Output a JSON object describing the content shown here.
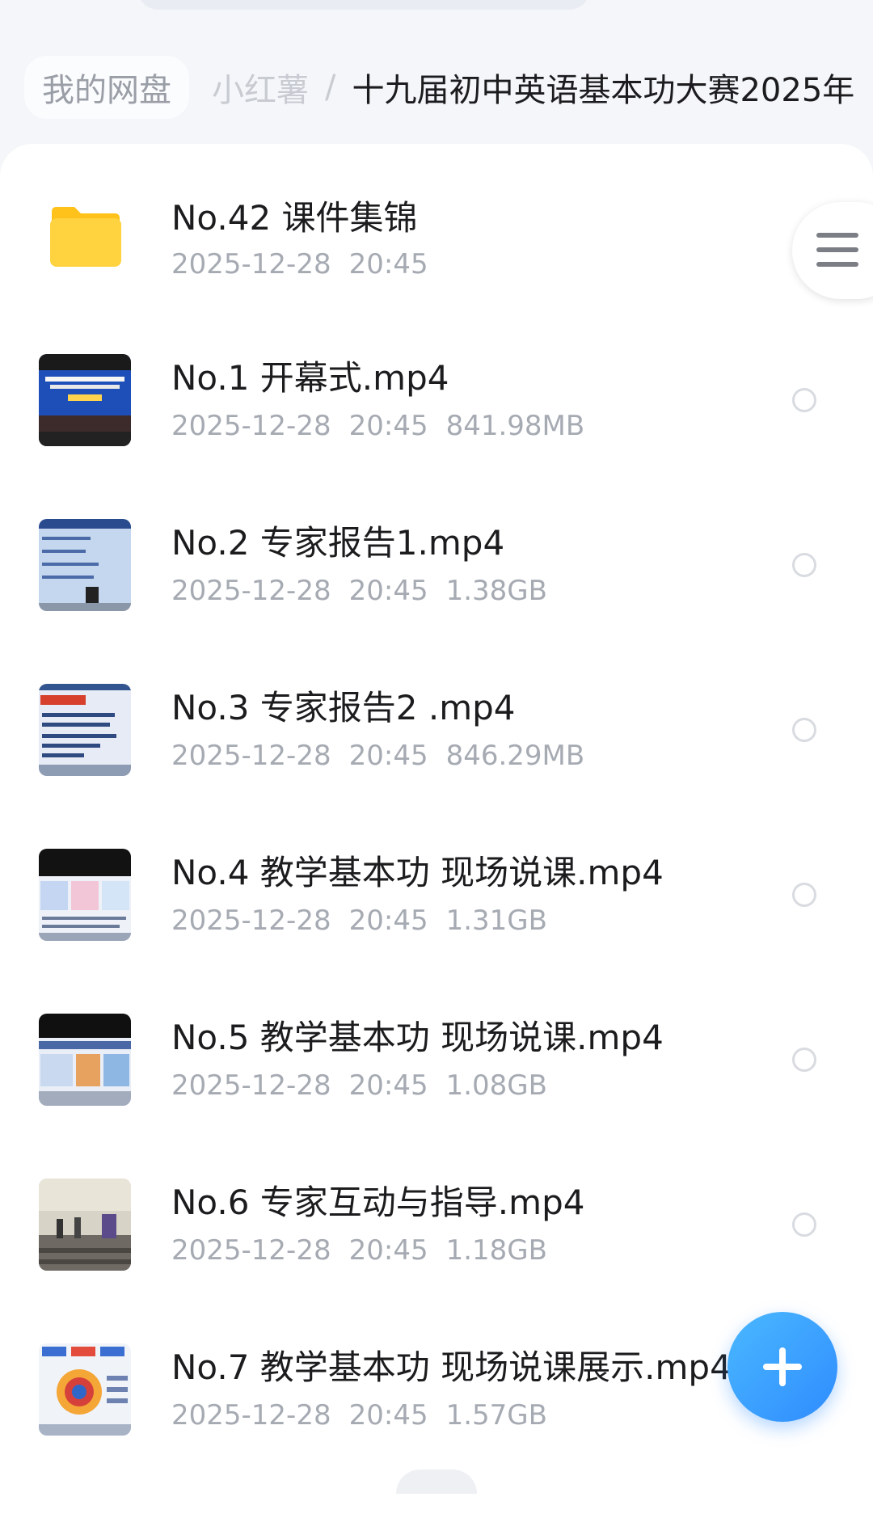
{
  "breadcrumb": {
    "root": "我的网盘",
    "middle": "小红薯",
    "separator": "/",
    "current": "十九届初中英语基本功大赛2025年"
  },
  "files": [
    {
      "name": "No.42 课件集锦",
      "date": "2025-12-28",
      "time": "20:45",
      "size": "",
      "type": "folder",
      "icon": "folder-icon"
    },
    {
      "name": "No.1 开幕式.mp4",
      "date": "2025-12-28",
      "time": "20:45",
      "size": "841.98MB",
      "type": "video",
      "icon": "video-thumbnail"
    },
    {
      "name": "No.2 专家报告1.mp4",
      "date": "2025-12-28",
      "time": "20:45",
      "size": "1.38GB",
      "type": "video",
      "icon": "video-thumbnail"
    },
    {
      "name": "No.3 专家报告2 .mp4",
      "date": "2025-12-28",
      "time": "20:45",
      "size": "846.29MB",
      "type": "video",
      "icon": "video-thumbnail"
    },
    {
      "name": "No.4  教学基本功 现场说课.mp4",
      "date": "2025-12-28",
      "time": "20:45",
      "size": "1.31GB",
      "type": "video",
      "icon": "video-thumbnail"
    },
    {
      "name": "No.5 教学基本功 现场说课.mp4",
      "date": "2025-12-28",
      "time": "20:45",
      "size": "1.08GB",
      "type": "video",
      "icon": "video-thumbnail"
    },
    {
      "name": "No.6 专家互动与指导.mp4",
      "date": "2025-12-28",
      "time": "20:45",
      "size": "1.18GB",
      "type": "video",
      "icon": "video-thumbnail"
    },
    {
      "name": "No.7 教学基本功 现场说课展示.mp4",
      "date": "2025-12-28",
      "time": "20:45",
      "size": "1.57GB",
      "type": "video",
      "icon": "video-thumbnail"
    }
  ],
  "controls": {
    "menu_icon": "hamburger-menu-icon",
    "fab_icon": "plus-icon"
  },
  "colors": {
    "accent": "#2f8cff",
    "folder": "#ffd23f",
    "meta_text": "#a6aab2"
  }
}
